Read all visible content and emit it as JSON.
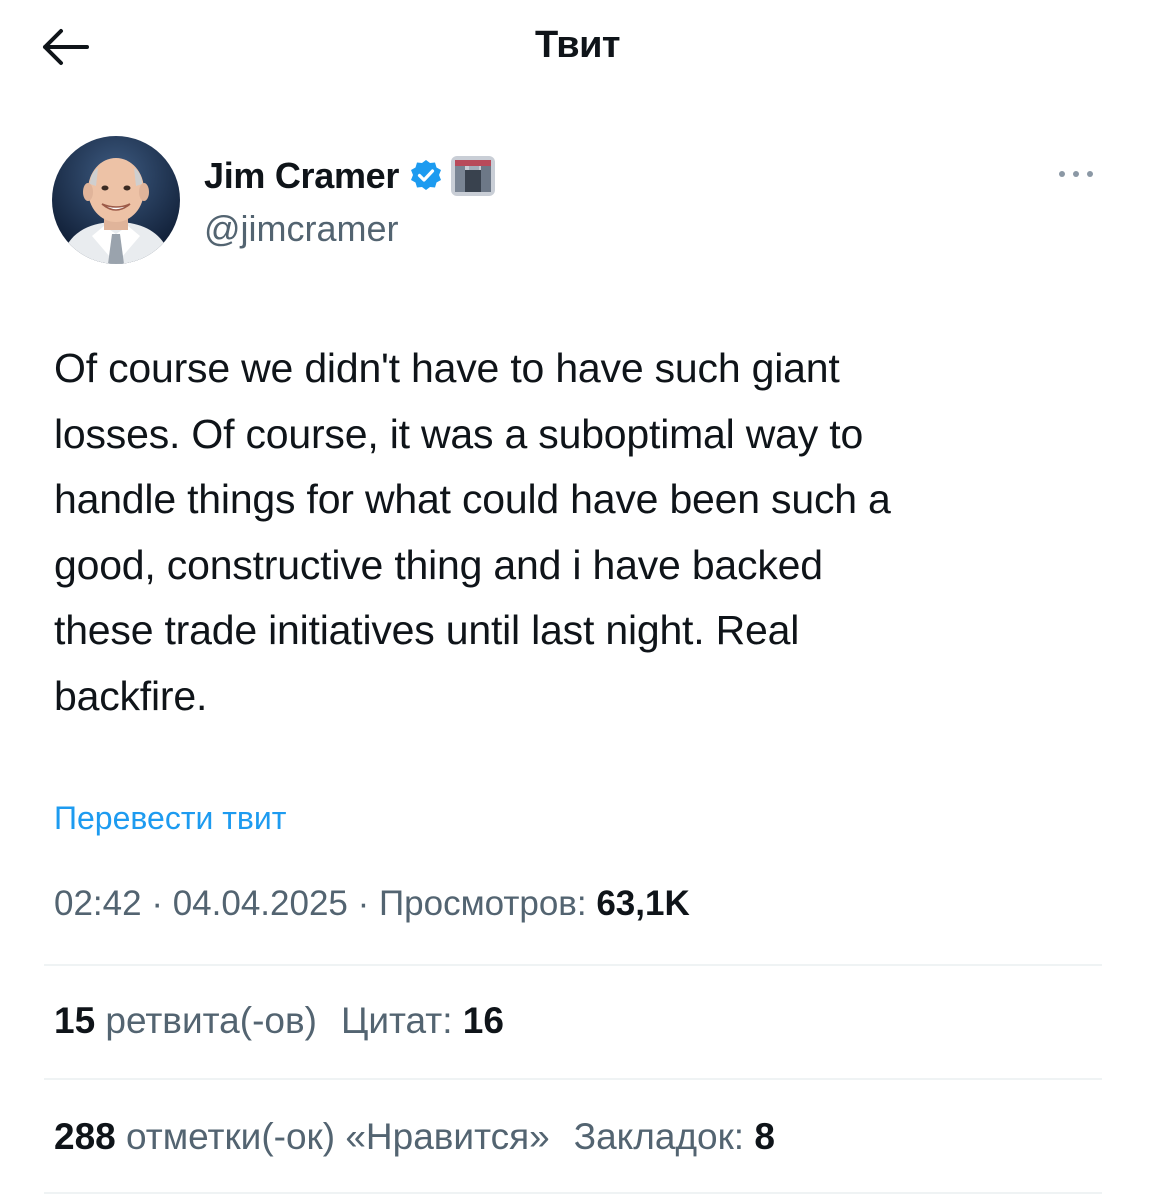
{
  "header": {
    "title": "Твит",
    "back_icon": "arrow-left-icon"
  },
  "author": {
    "name": "Jim Cramer",
    "handle": "@jimcramer",
    "verified": true,
    "verified_color": "#1d9bf0",
    "more_icon": "more-horizontal-icon"
  },
  "tweet": {
    "text": "Of course we didn't have to have such giant\nlosses. Of course, it was a suboptimal way to\nhandle things for what could have been such a\ngood, constructive thing and i have backed\nthese trade initiatives until last night. Real\nbackfire.",
    "translate_label": "Перевести твит",
    "time": "02:42",
    "date": "04.04.2025",
    "separator": " · ",
    "views_label": "Просмотров: ",
    "views_value": "63,1K"
  },
  "stats": {
    "retweets_count": "15",
    "retweets_label": " ретвита(-ов)",
    "quotes_label": "Цитат: ",
    "quotes_count": "16",
    "likes_count": "288",
    "likes_label": " отметки(-ок) «Нравится»",
    "bookmarks_label": "Закладок: ",
    "bookmarks_count": "8"
  },
  "colors": {
    "accent": "#1d9bf0",
    "text_primary": "#0f1419",
    "text_secondary": "#536471",
    "divider": "#eff3f4"
  }
}
